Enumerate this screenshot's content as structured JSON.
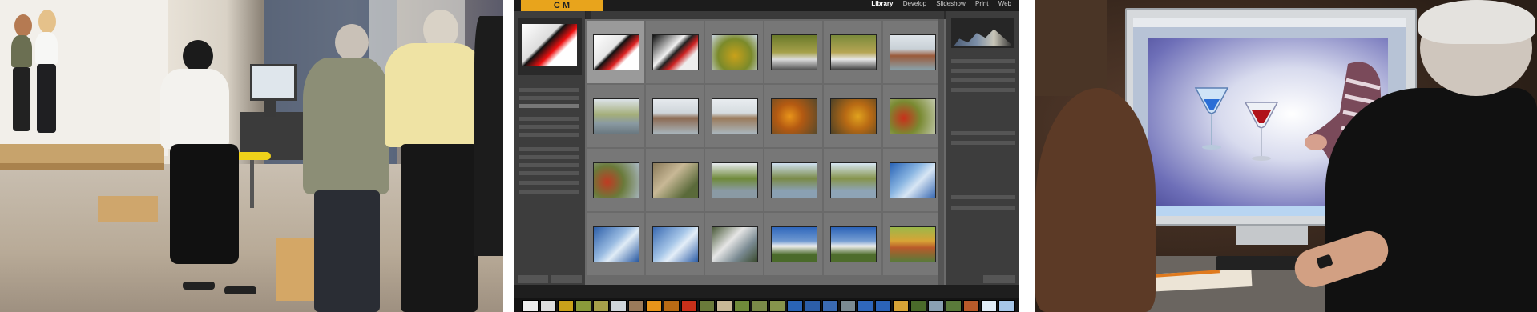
{
  "lightroom": {
    "logo_text": "C M",
    "menu": [
      "Library",
      "Develop",
      "Slideshow",
      "Print",
      "Web"
    ]
  },
  "colors": {
    "lightroom_logo": "#e8a41c",
    "stool": "#f0d21a",
    "screen_backdrop": "#5b5ca6"
  }
}
